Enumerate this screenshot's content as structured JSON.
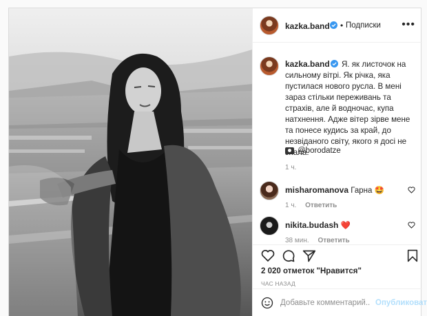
{
  "post": {
    "author": "kazka.band",
    "follow_label": "Подписки",
    "more_icon": "more-horizontal-icon",
    "caption": "Я. як листочок на сильному вітрі. Як річка, яка пустилася нового русла. В мені зараз стільки переживань та страхів, але й водночас, купа натхнення. Адже вітер зірве мене та понесе кудись за край, до незвіданого світу, якого я досі не знала.",
    "photo_credit": "@boroda​tze",
    "caption_time": "1 ч."
  },
  "comments": [
    {
      "user": "misharomanova",
      "text": "Гарна",
      "emoji": "🤩",
      "time": "1 ч.",
      "reply": "Ответить"
    },
    {
      "user": "nikita.budash",
      "text": "",
      "emoji": "❤️",
      "time": "38 мин.",
      "reply": "Ответить"
    }
  ],
  "stats": {
    "likes": "2 020 отметок \"Нравится\"",
    "time_ago": "ЧАС НАЗАД"
  },
  "add_comment": {
    "placeholder": "Добавьте комментарий...",
    "post_label": "Опубликовать"
  },
  "colors": {
    "verified_blue": "#3897f0",
    "link_blue": "#b2dffc",
    "heart_red": "#ed4956"
  }
}
